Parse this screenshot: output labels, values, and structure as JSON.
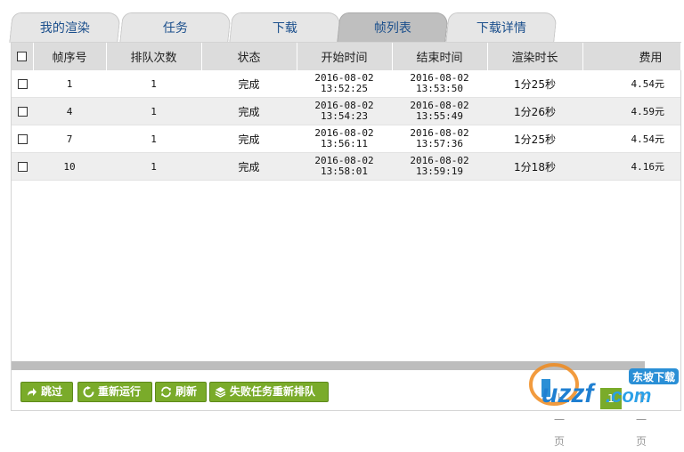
{
  "tabs": [
    {
      "label": "我的渲染",
      "active": false
    },
    {
      "label": "任务",
      "active": false
    },
    {
      "label": "下载",
      "active": false
    },
    {
      "label": "帧列表",
      "active": true
    },
    {
      "label": "下载详情",
      "active": false
    }
  ],
  "table": {
    "headers": [
      "帧序号",
      "排队次数",
      "状态",
      "开始时间",
      "结束时间",
      "渲染时长",
      "费用"
    ],
    "rows": [
      {
        "frame": "1",
        "queue": "1",
        "status": "完成",
        "start_date": "2016-08-02",
        "start_time": "13:52:25",
        "end_date": "2016-08-02",
        "end_time": "13:53:50",
        "duration": "1分25秒",
        "fee": "4.54元"
      },
      {
        "frame": "4",
        "queue": "1",
        "status": "完成",
        "start_date": "2016-08-02",
        "start_time": "13:54:23",
        "end_date": "2016-08-02",
        "end_time": "13:55:49",
        "duration": "1分26秒",
        "fee": "4.59元"
      },
      {
        "frame": "7",
        "queue": "1",
        "status": "完成",
        "start_date": "2016-08-02",
        "start_time": "13:56:11",
        "end_date": "2016-08-02",
        "end_time": "13:57:36",
        "duration": "1分25秒",
        "fee": "4.54元"
      },
      {
        "frame": "10",
        "queue": "1",
        "status": "完成",
        "start_date": "2016-08-02",
        "start_time": "13:58:01",
        "end_date": "2016-08-02",
        "end_time": "13:59:19",
        "duration": "1分18秒",
        "fee": "4.16元"
      }
    ]
  },
  "actions": {
    "skip": "跳过",
    "rerun": "重新运行",
    "refresh": "刷新",
    "requeue_failed": "失败任务重新排队"
  },
  "pager": {
    "prev": "上一页",
    "current": "1",
    "next": "下一页"
  },
  "watermark": {
    "brand": "uzzf.com",
    "tag": "东坡下载"
  },
  "colors": {
    "accent_green": "#7aab2a",
    "tab_text": "#1b4f8c",
    "header_bg": "#dcdcdc"
  }
}
